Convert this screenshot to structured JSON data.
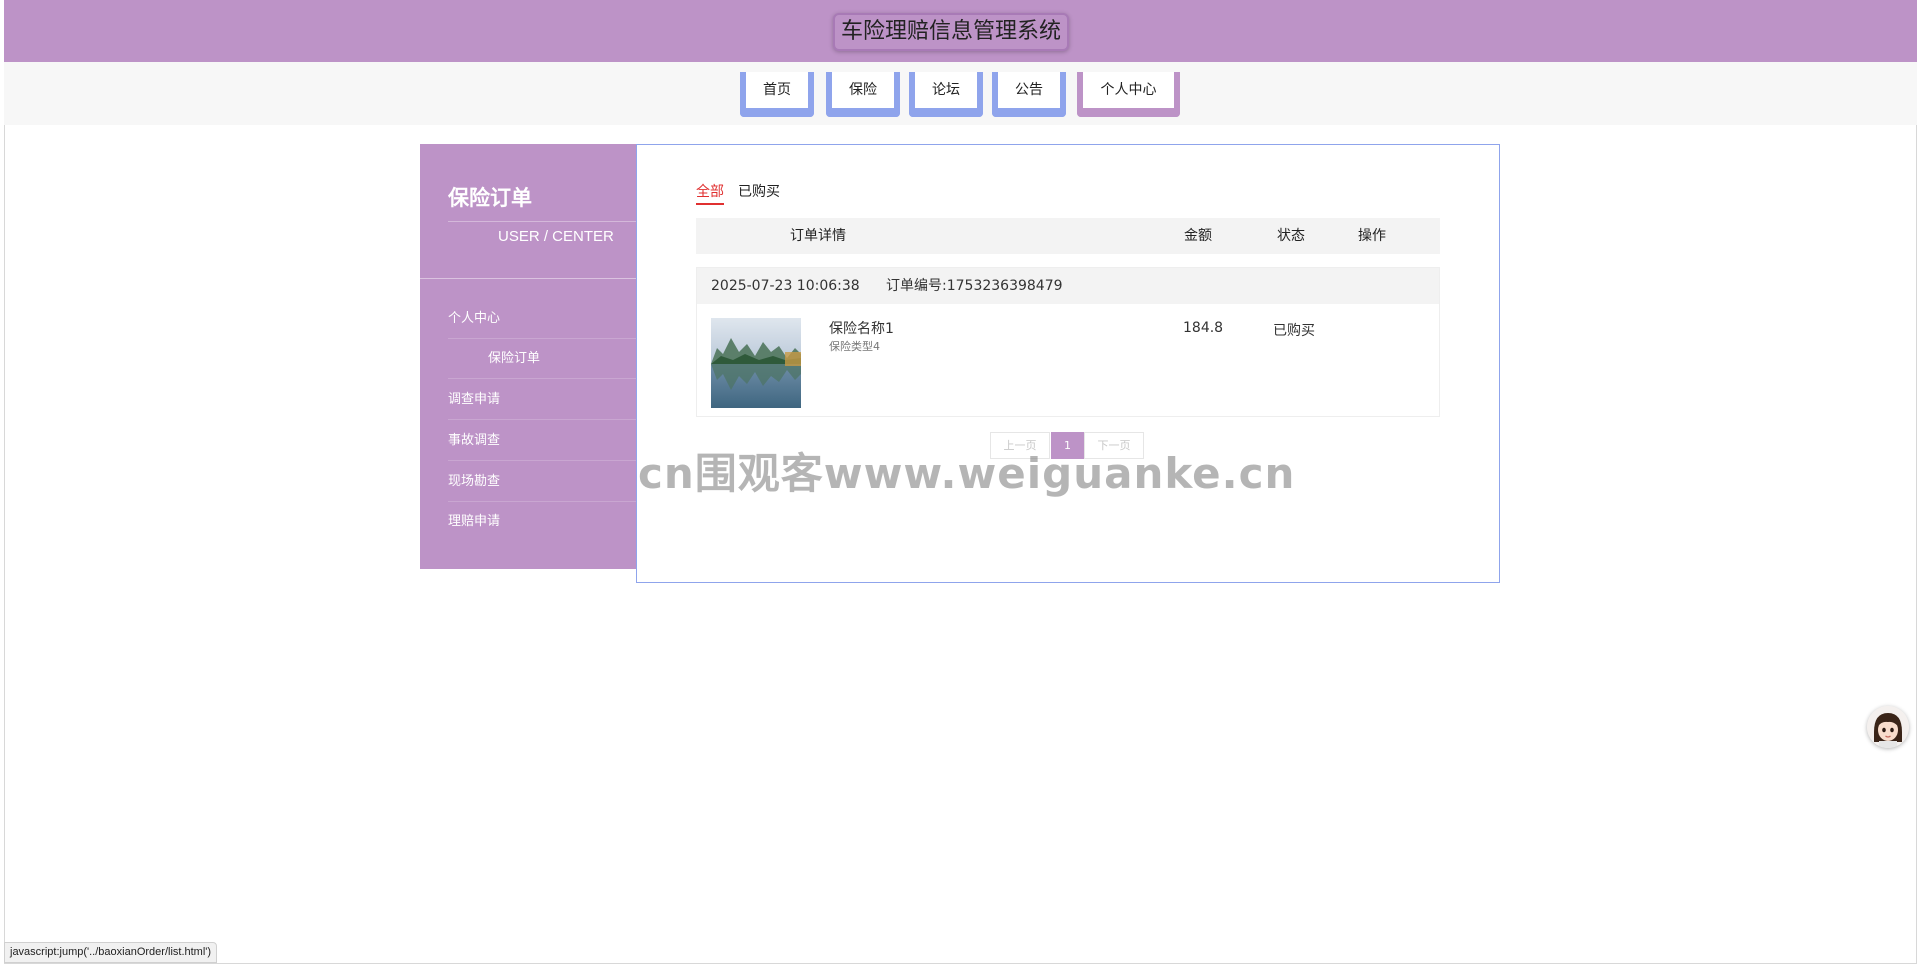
{
  "header": {
    "title": "车险理赔信息管理系统"
  },
  "nav": {
    "items": [
      {
        "label": "首页"
      },
      {
        "label": "保险"
      },
      {
        "label": "论坛"
      },
      {
        "label": "公告"
      },
      {
        "label": "个人中心"
      }
    ],
    "active_index": 4
  },
  "sidebar": {
    "title": "保险订单",
    "subtitle": "USER / CENTER",
    "items": [
      {
        "label": "个人中心"
      },
      {
        "label": "保险订单"
      },
      {
        "label": "调查申请"
      },
      {
        "label": "事故调查"
      },
      {
        "label": "现场勘查"
      },
      {
        "label": "理赔申请"
      }
    ]
  },
  "main": {
    "tabs": [
      {
        "label": "全部"
      },
      {
        "label": "已购买"
      }
    ],
    "active_tab": 0,
    "columns": {
      "detail": "订单详情",
      "amount": "金额",
      "status": "状态",
      "action": "操作"
    },
    "orders": [
      {
        "time": "2025-07-23 10:06:38",
        "order_no": "订单编号:1753236398479",
        "name": "保险名称1",
        "type": "保险类型4",
        "amount": "184.8",
        "status": "已购买"
      }
    ],
    "pagination": {
      "prev": "上一页",
      "current": "1",
      "next": "下一页"
    }
  },
  "watermark": "cn围观客www.weiguanke.cn",
  "statusbar": {
    "text": "javascript:jump('../baoxianOrder/list.html')"
  },
  "colors": {
    "primary": "#bd93c7",
    "nav_accent": "#8fa4ec",
    "tab_active": "#e03030"
  },
  "icons": {
    "avatar": "assistant-avatar-icon"
  }
}
